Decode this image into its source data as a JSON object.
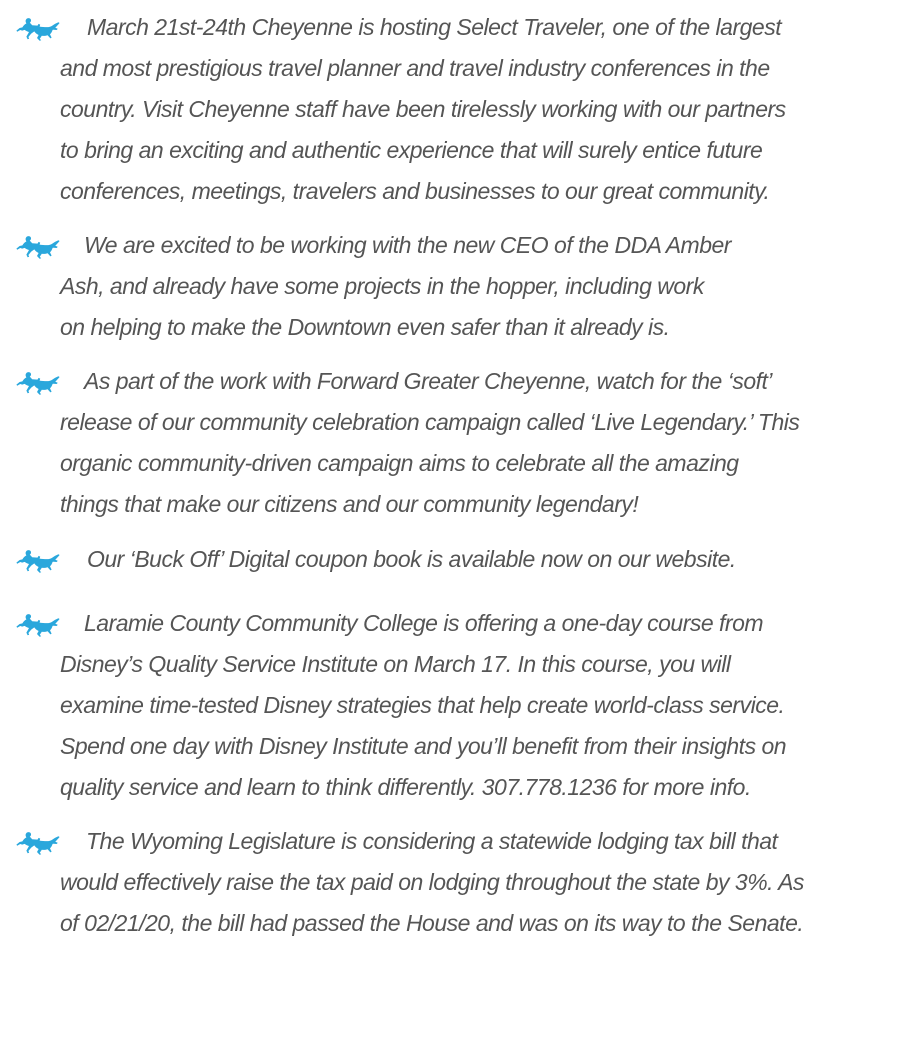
{
  "bullet_icon": {
    "name": "horse-and-rider-icon",
    "color": "#2aa7dc"
  },
  "text_color": "#555555",
  "bullets": [
    {
      "lines": [
        "March 21st-24th Cheyenne is hosting Select Traveler, one of the largest",
        "and most prestigious travel planner and travel industry conferences in the",
        "country.  Visit Cheyenne staff have been tirelessly working with our partners",
        "to bring an exciting and authentic experience that will surely entice future",
        "conferences, meetings, travelers and businesses to our great community."
      ]
    },
    {
      "lines": [
        "We are excited to be working with the new CEO of the DDA Amber",
        "Ash, and already have some projects in the hopper, including work",
        "on helping to make the Downtown even safer than it already is."
      ]
    },
    {
      "lines": [
        "As part of the work with Forward Greater Cheyenne, watch for the ‘soft’",
        "release of our community celebration campaign called ‘Live Legendary.’  This",
        "organic community-driven campaign aims to celebrate all the amazing",
        "things that make our citizens and our community legendary!"
      ]
    },
    {
      "lines": [
        "Our ‘Buck Off’ Digital coupon book is available now on our website."
      ]
    },
    {
      "lines": [
        "Laramie County Community College is offering a one-day course from",
        "Disney’s Quality Service Institute on March 17. In this course, you will",
        "examine time-tested Disney strategies that help create world-class service.",
        "Spend one day with Disney Institute and you’ll benefit from their insights on",
        "quality service and learn to think differently. 307.778.1236 for more info."
      ]
    },
    {
      "lines": [
        "The Wyoming Legislature is considering a statewide lodging tax bill that",
        "would effectively raise the tax paid on lodging throughout the state by 3%. As",
        "of 02/21/20, the bill had passed the House and was on its way to the Senate."
      ]
    }
  ]
}
